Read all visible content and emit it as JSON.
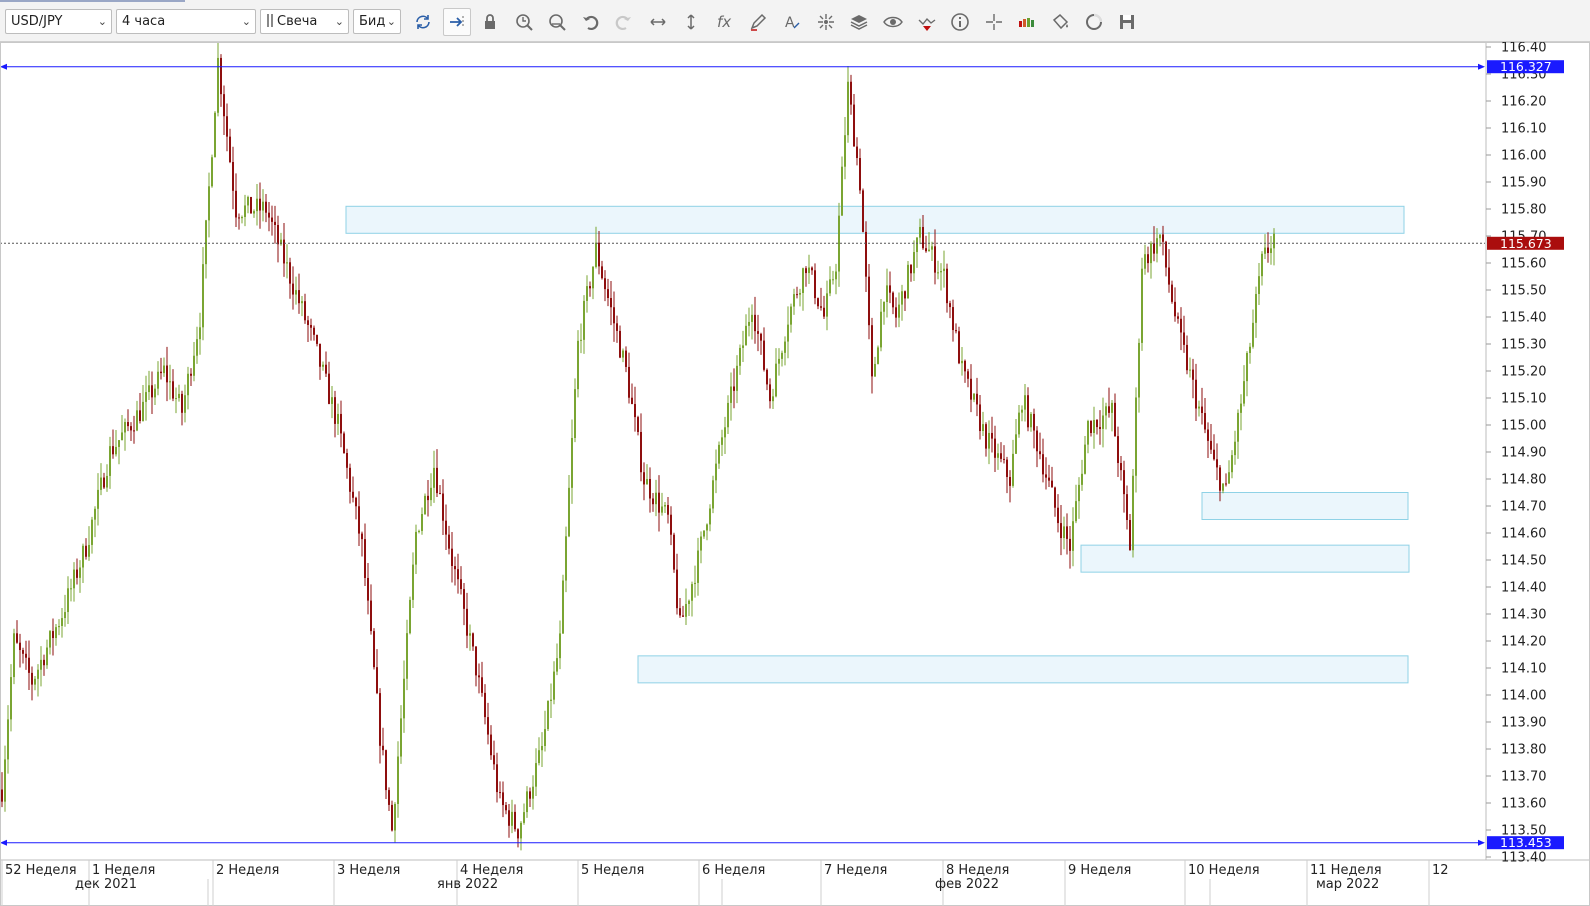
{
  "toolbar": {
    "symbol": "USD/JPY",
    "timeframe": "4 часа",
    "chart_type": "Свеча",
    "price_type": "Бид",
    "icons": [
      "refresh-icon",
      "scroll-to-end-icon",
      "lock-icon",
      "zoom-in-icon",
      "zoom-out-icon",
      "undo-icon",
      "redo-icon",
      "horizontal-resize-icon",
      "vertical-resize-icon",
      "indicators-fx-icon",
      "draw-pencil-icon",
      "text-tool-icon",
      "crosshair-node-icon",
      "layers-icon",
      "eye-icon",
      "signal-icon",
      "info-icon",
      "cross-cursor-icon",
      "volume-bars-icon",
      "fill-bucket-icon",
      "cycle-icon",
      "save-icon"
    ]
  },
  "colors": {
    "bull": "#7aa532",
    "bear": "#8e0e0e",
    "grid_line": "#1a1aff",
    "current_price": "#aa0d0d",
    "zone_fill": "#e8f4fb",
    "zone_border": "#8fd2e6"
  },
  "chart_data": {
    "type": "candlestick",
    "symbol": "USD/JPY",
    "timeframe": "4 часа",
    "ylim": [
      113.4,
      116.4
    ],
    "y_ticks": [
      "116.40",
      "116.30",
      "116.20",
      "116.10",
      "116.00",
      "115.90",
      "115.80",
      "115.70",
      "115.60",
      "115.50",
      "115.40",
      "115.30",
      "115.20",
      "115.10",
      "115.00",
      "114.90",
      "114.80",
      "114.70",
      "114.60",
      "114.50",
      "114.40",
      "114.30",
      "114.20",
      "114.10",
      "114.00",
      "113.90",
      "113.80",
      "113.70",
      "113.60",
      "113.50",
      "113.40"
    ],
    "week_labels": [
      "52 Неделя",
      "1 Неделя",
      "2 Неделя",
      "3 Неделя",
      "4 Неделя",
      "5 Неделя",
      "6 Неделя",
      "7 Неделя",
      "8 Неделя",
      "9 Неделя",
      "10 Неделя",
      "11 Неделя",
      "12"
    ],
    "month_labels": [
      "дек 2021",
      "янв 2022",
      "фев 2022",
      "мар 2022"
    ],
    "horizontal_lines": [
      {
        "price": 116.327,
        "label": "116.327"
      },
      {
        "price": 113.453,
        "label": "113.453"
      }
    ],
    "current_price": {
      "price": 115.673,
      "label": "115.673"
    },
    "zones": [
      {
        "top": 115.81,
        "bottom": 115.71
      },
      {
        "top": 114.75,
        "bottom": 114.65
      },
      {
        "top": 114.555,
        "bottom": 114.455
      },
      {
        "top": 114.145,
        "bottom": 114.045
      }
    ],
    "waypoints": [
      [
        0,
        113.65
      ],
      [
        4,
        114.2
      ],
      [
        10,
        114.05
      ],
      [
        20,
        114.3
      ],
      [
        28,
        114.55
      ],
      [
        36,
        114.9
      ],
      [
        46,
        115.05
      ],
      [
        54,
        115.2
      ],
      [
        60,
        115.05
      ],
      [
        66,
        115.4
      ],
      [
        72,
        116.35
      ],
      [
        78,
        115.8
      ],
      [
        88,
        115.8
      ],
      [
        96,
        115.55
      ],
      [
        104,
        115.3
      ],
      [
        112,
        115.0
      ],
      [
        120,
        114.55
      ],
      [
        126,
        113.85
      ],
      [
        130,
        113.5
      ],
      [
        138,
        114.6
      ],
      [
        144,
        114.85
      ],
      [
        150,
        114.5
      ],
      [
        158,
        114.1
      ],
      [
        166,
        113.6
      ],
      [
        172,
        113.5
      ],
      [
        180,
        113.8
      ],
      [
        186,
        114.2
      ],
      [
        192,
        115.3
      ],
      [
        198,
        115.65
      ],
      [
        208,
        115.2
      ],
      [
        214,
        114.8
      ],
      [
        222,
        114.65
      ],
      [
        226,
        114.25
      ],
      [
        232,
        114.5
      ],
      [
        240,
        114.95
      ],
      [
        250,
        115.45
      ],
      [
        256,
        115.1
      ],
      [
        262,
        115.4
      ],
      [
        268,
        115.6
      ],
      [
        274,
        115.4
      ],
      [
        278,
        115.6
      ],
      [
        282,
        116.25
      ],
      [
        286,
        115.9
      ],
      [
        290,
        115.15
      ],
      [
        294,
        115.5
      ],
      [
        298,
        115.4
      ],
      [
        306,
        115.7
      ],
      [
        314,
        115.55
      ],
      [
        320,
        115.2
      ],
      [
        328,
        114.95
      ],
      [
        336,
        114.8
      ],
      [
        340,
        115.1
      ],
      [
        346,
        114.9
      ],
      [
        352,
        114.65
      ],
      [
        356,
        114.55
      ],
      [
        362,
        115.0
      ],
      [
        370,
        115.05
      ],
      [
        376,
        114.55
      ],
      [
        380,
        115.6
      ],
      [
        386,
        115.7
      ],
      [
        392,
        115.35
      ],
      [
        398,
        115.1
      ],
      [
        404,
        114.85
      ],
      [
        408,
        114.75
      ],
      [
        414,
        115.15
      ],
      [
        420,
        115.6
      ],
      [
        424,
        115.7
      ]
    ]
  }
}
